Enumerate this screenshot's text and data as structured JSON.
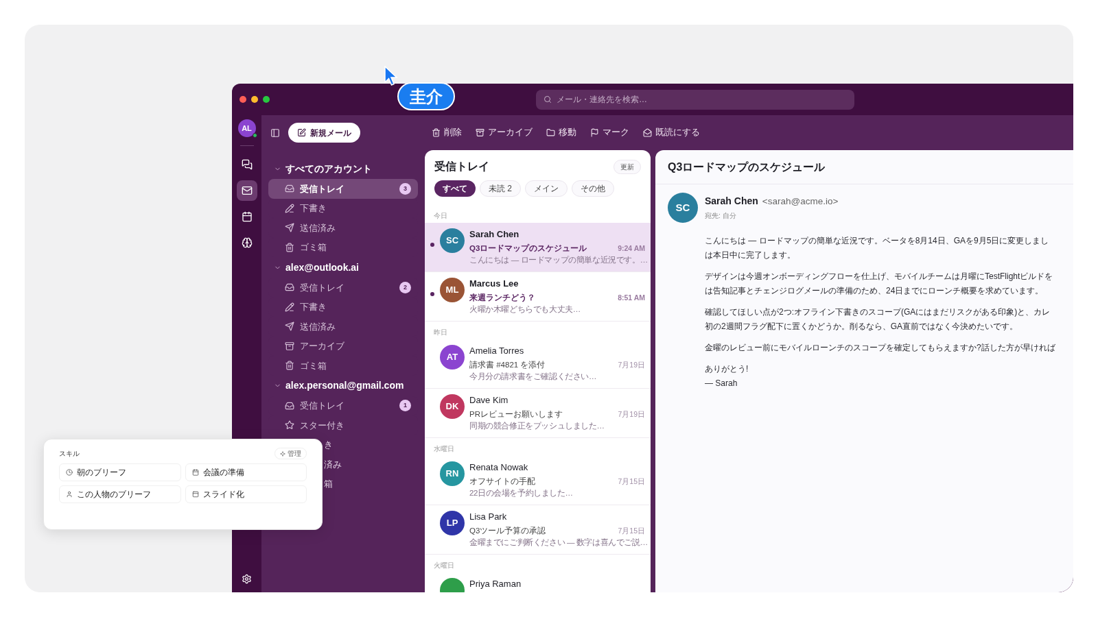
{
  "cursor": {
    "name": "圭介"
  },
  "search": {
    "placeholder": "メール・連絡先を検索…"
  },
  "rail": {
    "avatar": "AL",
    "online": true,
    "items": [
      {
        "kind": "chat",
        "selected": false
      },
      {
        "kind": "mail",
        "selected": true
      },
      {
        "kind": "calendar",
        "selected": false
      },
      {
        "kind": "brain",
        "selected": false
      }
    ]
  },
  "compose": {
    "label": "新規メール"
  },
  "toolbar": [
    {
      "kind": "delete",
      "label": "削除"
    },
    {
      "kind": "archive",
      "label": "アーカイブ"
    },
    {
      "kind": "move",
      "label": "移動"
    },
    {
      "kind": "mark",
      "label": "マーク"
    },
    {
      "kind": "read",
      "label": "既読にする"
    }
  ],
  "accounts": [
    {
      "name": "すべてのアカウント",
      "expanded": true,
      "folders": [
        {
          "kind": "inbox",
          "label": "受信トレイ",
          "count": "3",
          "selected": true
        },
        {
          "kind": "drafts",
          "label": "下書き",
          "selected": false
        },
        {
          "kind": "sent",
          "label": "送信済み",
          "selected": false
        },
        {
          "kind": "trash",
          "label": "ゴミ箱",
          "selected": false
        }
      ]
    },
    {
      "name": "alex@outlook.ai",
      "expanded": true,
      "folders": [
        {
          "kind": "inbox",
          "label": "受信トレイ",
          "count": "2",
          "selected": false
        },
        {
          "kind": "drafts",
          "label": "下書き",
          "selected": false
        },
        {
          "kind": "sent",
          "label": "送信済み",
          "selected": false
        },
        {
          "kind": "archive",
          "label": "アーカイブ",
          "selected": false
        },
        {
          "kind": "trash",
          "label": "ゴミ箱",
          "selected": false
        }
      ]
    },
    {
      "name": "alex.personal@gmail.com",
      "expanded": true,
      "folders": [
        {
          "kind": "inbox",
          "label": "受信トレイ",
          "count": "1",
          "selected": false
        },
        {
          "kind": "starred",
          "label": "スター付き",
          "selected": false
        },
        {
          "kind": "clipped",
          "label": "き"
        },
        {
          "kind": "clipped",
          "label": "済み"
        },
        {
          "kind": "clipped",
          "label": "箱"
        }
      ]
    }
  ],
  "list": {
    "title": "受信トレイ",
    "refresh": "更新",
    "filters": [
      {
        "label": "すべて",
        "selected": true
      },
      {
        "label": "未読 2",
        "selected": false
      },
      {
        "label": "メイン",
        "selected": false
      },
      {
        "label": "その他",
        "selected": false
      }
    ],
    "groups": [
      {
        "label": "今日",
        "messages": [
          {
            "initials": "SC",
            "color": "#2a7f9e",
            "sender": "Sarah Chen",
            "subject": "Q3ロードマップのスケジュール",
            "time": "9:24 AM",
            "preview": "こんにちは — ロードマップの簡単な近況です。…",
            "unread": true,
            "selected": true
          },
          {
            "initials": "ML",
            "color": "#9a5435",
            "sender": "Marcus Lee",
            "subject": "来週ランチどう？",
            "time": "8:51 AM",
            "preview": "火曜か木曜どちらでも大丈夫…",
            "unread": true,
            "selected": false
          }
        ]
      },
      {
        "label": "昨日",
        "messages": [
          {
            "initials": "AT",
            "color": "#8b44d0",
            "sender": "Amelia Torres",
            "subject": "請求書 #4821 を添付",
            "time": "7月19日",
            "preview": "今月分の請求書をご確認ください…",
            "unread": false,
            "selected": false
          },
          {
            "initials": "DK",
            "color": "#c0375f",
            "sender": "Dave Kim",
            "subject": "PRレビューお願いします",
            "time": "7月19日",
            "preview": "同期の競合修正をプッシュしました…",
            "unread": false,
            "selected": false
          }
        ]
      },
      {
        "label": "水曜日",
        "messages": [
          {
            "initials": "RN",
            "color": "#2596a0",
            "sender": "Renata Nowak",
            "subject": "オフサイトの手配",
            "time": "7月15日",
            "preview": "22日の会場を予約しました…",
            "unread": false,
            "selected": false
          },
          {
            "initials": "LP",
            "color": "#2f35a8",
            "sender": "Lisa Park",
            "subject": "Q3ツール予算の承認",
            "time": "7月15日",
            "preview": "金曜までにご判断ください — 数字は喜んでご説…",
            "unread": false,
            "selected": false
          }
        ]
      },
      {
        "label": "火曜日",
        "messages": [
          {
            "color": "#2e9e4a",
            "sender": "Priya Raman",
            "unread": false,
            "selected": false
          }
        ]
      }
    ]
  },
  "reader": {
    "subject": "Q3ロードマップのスケジュール",
    "initials": "SC",
    "color": "#2a7f9e",
    "from": "Sarah Chen",
    "email": "<sarah@acme.io>",
    "to": "宛先: 自分",
    "paragraphs": [
      [
        "こんにちは — ロードマップの簡単な近況です。ベータを8月14日、GAを9月5日に変更しまし",
        "は本日中に完了します。"
      ],
      [
        "デザインは今週オンボーディングフローを仕上げ、モバイルチームは月曜にTestFlightビルドを",
        "は告知記事とチェンジログメールの準備のため、24日までにローンチ概要を求めています。"
      ],
      [
        "確認してほしい点が2つ:オフライン下書きのスコープ(GAにはまだリスクがある印象)と、カレ",
        "初の2週間フラグ配下に置くかどうか。削るなら、GA直前ではなく今決めたいです。"
      ],
      [
        "金曜のレビュー前にモバイルローンチのスコープを確定してもらえますか?話した方が早ければ"
      ],
      [
        "ありがとう!",
        "— Sarah"
      ]
    ]
  },
  "skills": {
    "title": "スキル",
    "manage": "管理",
    "items": [
      {
        "kind": "clock",
        "label": "朝のブリーフ"
      },
      {
        "kind": "calendar",
        "label": "会議の準備"
      },
      {
        "kind": "person",
        "label": "この人物のブリーフ"
      },
      {
        "kind": "slides",
        "label": "スライド化"
      }
    ]
  }
}
